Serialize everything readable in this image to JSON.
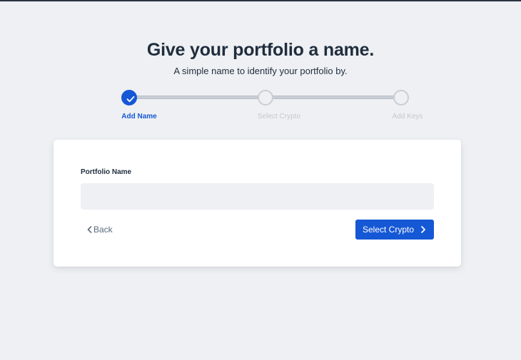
{
  "header": {
    "title": "Give your portfolio a name.",
    "subtitle": "A simple name to identify your portfolio by."
  },
  "stepper": {
    "steps": [
      {
        "label": "Add Name",
        "state": "complete",
        "icon": "check-icon"
      },
      {
        "label": "Select Crypto",
        "state": "upcoming"
      },
      {
        "label": "Add Keys",
        "state": "upcoming"
      }
    ]
  },
  "form": {
    "field_label": "Portfolio Name",
    "field_value": "",
    "field_placeholder": "",
    "back_label": "Back",
    "back_icon": "chevron-left-icon",
    "next_label": "Select Crypto",
    "next_icon": "chevron-right-icon"
  },
  "colors": {
    "accent": "#1558d6",
    "background": "#eef0f3",
    "text": "#1f2d3d",
    "muted": "#c3c8d0"
  }
}
